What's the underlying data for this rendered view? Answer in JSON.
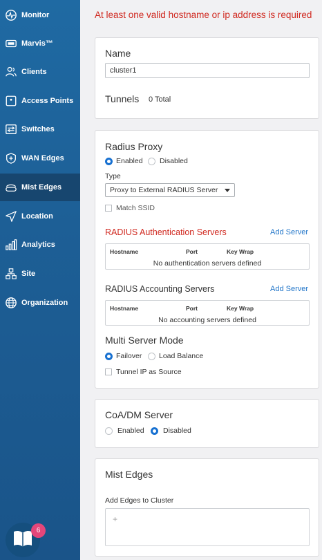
{
  "sidebar": {
    "items": [
      {
        "label": "Monitor",
        "icon": "monitor-icon"
      },
      {
        "label": "Marvis™",
        "icon": "marvis-icon"
      },
      {
        "label": "Clients",
        "icon": "clients-icon"
      },
      {
        "label": "Access Points",
        "icon": "access-point-icon"
      },
      {
        "label": "Switches",
        "icon": "switches-icon"
      },
      {
        "label": "WAN Edges",
        "icon": "wan-edges-icon"
      },
      {
        "label": "Mist Edges",
        "icon": "mist-edges-icon",
        "active": true
      },
      {
        "label": "Location",
        "icon": "location-icon"
      },
      {
        "label": "Analytics",
        "icon": "analytics-icon"
      },
      {
        "label": "Site",
        "icon": "site-icon"
      },
      {
        "label": "Organization",
        "icon": "organization-icon"
      }
    ],
    "help_badge_count": "6"
  },
  "error_message": "At least one valid hostname or ip address is required",
  "name_card": {
    "name_label": "Name",
    "name_value": "cluster1",
    "tunnels_label": "Tunnels",
    "tunnels_total": "0 Total"
  },
  "radius_card": {
    "title": "Radius Proxy",
    "enabled_label": "Enabled",
    "disabled_label": "Disabled",
    "type_label": "Type",
    "type_value": "Proxy to External RADIUS Server",
    "match_ssid_label": "Match SSID",
    "auth_servers_title": "RADIUS Authentication Servers",
    "auth_add_server": "Add Server",
    "auth_columns": [
      "Hostname",
      "Port",
      "Key Wrap"
    ],
    "auth_empty": "No authentication servers defined",
    "acct_servers_title": "RADIUS Accounting Servers",
    "acct_add_server": "Add Server",
    "acct_columns": [
      "Hostname",
      "Port",
      "Key Wrap"
    ],
    "acct_empty": "No accounting servers defined",
    "multi_server_title": "Multi Server Mode",
    "failover_label": "Failover",
    "load_balance_label": "Load Balance",
    "tunnel_ip_label": "Tunnel IP as Source"
  },
  "coa_card": {
    "title": "CoA/DM Server",
    "enabled_label": "Enabled",
    "disabled_label": "Disabled"
  },
  "mist_edges_card": {
    "title": "Mist Edges",
    "add_edges_label": "Add Edges to Cluster",
    "add_symbol": "+"
  },
  "colors": {
    "sidebar": "#1d5f96",
    "sidebar_active": "#17466f",
    "error": "#d0281f",
    "link": "#1f74c8",
    "radio_selected": "#1871d1",
    "badge": "#e4467a"
  }
}
